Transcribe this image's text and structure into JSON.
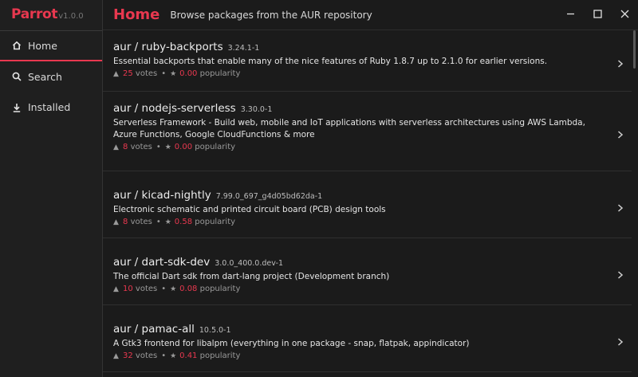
{
  "app": {
    "name": "Parrot",
    "version": "v1.0.0"
  },
  "sidebar": {
    "items": [
      {
        "label": "Home",
        "icon": "home-icon"
      },
      {
        "label": "Search",
        "icon": "search-icon"
      },
      {
        "label": "Installed",
        "icon": "download-icon"
      }
    ]
  },
  "header": {
    "title": "Home",
    "subtitle": "Browse packages from the AUR repository"
  },
  "packages": [
    {
      "name": "aur / ruby-backports",
      "version": "3.24.1-1",
      "description": "Essential backports that enable many of the nice features of Ruby 1.8.7 up to 2.1.0 for earlier versions.",
      "votes": "25",
      "votes_label": "votes",
      "popularity": "0.00",
      "popularity_label": "popularity"
    },
    {
      "name": "aur / nodejs-serverless",
      "version": "3.30.0-1",
      "description": "Serverless Framework - Build web, mobile and IoT applications with serverless architectures using AWS Lambda, Azure Functions, Google CloudFunctions & more",
      "votes": "8",
      "votes_label": "votes",
      "popularity": "0.00",
      "popularity_label": "popularity"
    },
    {
      "name": "aur / kicad-nightly",
      "version": "7.99.0_697_g4d05bd62da-1",
      "description": "Electronic schematic and printed circuit board (PCB) design tools",
      "votes": "8",
      "votes_label": "votes",
      "popularity": "0.58",
      "popularity_label": "popularity"
    },
    {
      "name": "aur / dart-sdk-dev",
      "version": "3.0.0_400.0.dev-1",
      "description": "The official Dart sdk from dart-lang project (Development branch)",
      "votes": "10",
      "votes_label": "votes",
      "popularity": "0.08",
      "popularity_label": "popularity"
    },
    {
      "name": "aur / pamac-all",
      "version": "10.5.0-1",
      "description": "A Gtk3 frontend for libalpm (everything in one package - snap, flatpak, appindicator)",
      "votes": "32",
      "votes_label": "votes",
      "popularity": "0.41",
      "popularity_label": "popularity"
    }
  ],
  "colors": {
    "accent": "#e8384f",
    "background": "#1b1b1b",
    "sidebar": "#1f1f1f"
  }
}
